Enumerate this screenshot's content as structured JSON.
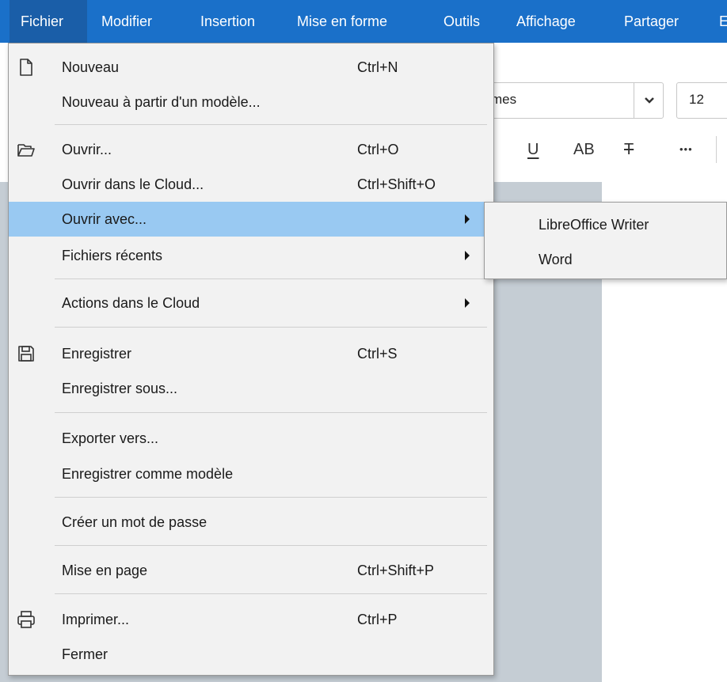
{
  "menubar": {
    "items": [
      "Fichier",
      "Modifier",
      "Insertion",
      "Mise en forme",
      "Outils",
      "Affichage",
      "Partager",
      "E"
    ],
    "active_index": 0,
    "color": "#1a70c9"
  },
  "toolbar": {
    "font_name_partial": "mes",
    "font_size": "12",
    "underline_glyph": "U",
    "caps_glyph": "AB",
    "strike_glyph": "T",
    "more_glyph": "•••"
  },
  "file_menu": {
    "items": [
      {
        "label": "Nouveau",
        "shortcut": "Ctrl+N",
        "icon": "new-document-icon"
      },
      {
        "label": "Nouveau à partir d'un modèle...",
        "shortcut": ""
      },
      {
        "label": "Ouvrir...",
        "shortcut": "Ctrl+O",
        "icon": "open-folder-icon"
      },
      {
        "label": "Ouvrir dans le Cloud...",
        "shortcut": "Ctrl+Shift+O"
      },
      {
        "label": "Ouvrir avec...",
        "shortcut": "",
        "submenu": true,
        "highlighted": true
      },
      {
        "label": "Fichiers récents",
        "shortcut": "",
        "submenu": true
      },
      {
        "label": "Actions dans le Cloud",
        "shortcut": "",
        "submenu": true
      },
      {
        "label": "Enregistrer",
        "shortcut": "Ctrl+S",
        "icon": "save-icon"
      },
      {
        "label": "Enregistrer sous...",
        "shortcut": ""
      },
      {
        "label": "Exporter vers...",
        "shortcut": ""
      },
      {
        "label": "Enregistrer comme modèle",
        "shortcut": ""
      },
      {
        "label": "Créer un mot de passe",
        "shortcut": ""
      },
      {
        "label": "Mise en page",
        "shortcut": "Ctrl+Shift+P"
      },
      {
        "label": "Imprimer...",
        "shortcut": "Ctrl+P",
        "icon": "printer-icon"
      },
      {
        "label": "Fermer",
        "shortcut": ""
      }
    ],
    "highlight_color": "#99c9f2"
  },
  "open_with_submenu": {
    "items": [
      "LibreOffice Writer",
      "Word"
    ]
  }
}
